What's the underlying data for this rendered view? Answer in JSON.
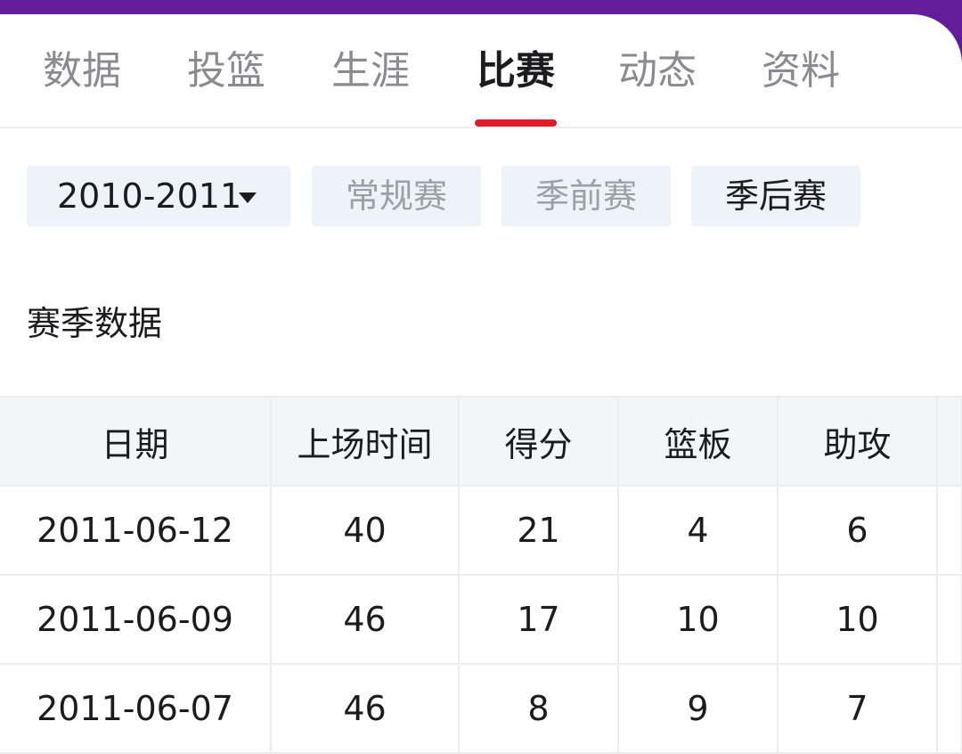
{
  "tabs": [
    {
      "label": "数据",
      "active": false
    },
    {
      "label": "投篮",
      "active": false
    },
    {
      "label": "生涯",
      "active": false
    },
    {
      "label": "比赛",
      "active": true
    },
    {
      "label": "动态",
      "active": false
    },
    {
      "label": "资料",
      "active": false
    }
  ],
  "filters": {
    "season": "2010-2011",
    "types": [
      {
        "label": "常规赛",
        "selected": false
      },
      {
        "label": "季前赛",
        "selected": false
      },
      {
        "label": "季后赛",
        "selected": true
      }
    ]
  },
  "section_title": "赛季数据",
  "table": {
    "headers": [
      "日期",
      "上场时间",
      "得分",
      "篮板",
      "助攻"
    ],
    "rows": [
      [
        "2011-06-12",
        "40",
        "21",
        "4",
        "6"
      ],
      [
        "2011-06-09",
        "46",
        "17",
        "10",
        "10"
      ],
      [
        "2011-06-07",
        "46",
        "8",
        "9",
        "7"
      ]
    ]
  },
  "colors": {
    "accent": "#e11b2b",
    "header_bar": "#641d9a",
    "filter_bg": "#eef2f9",
    "table_header_bg": "#f3f5f8"
  },
  "icons": {
    "season_dropdown": "caret-down-icon"
  }
}
